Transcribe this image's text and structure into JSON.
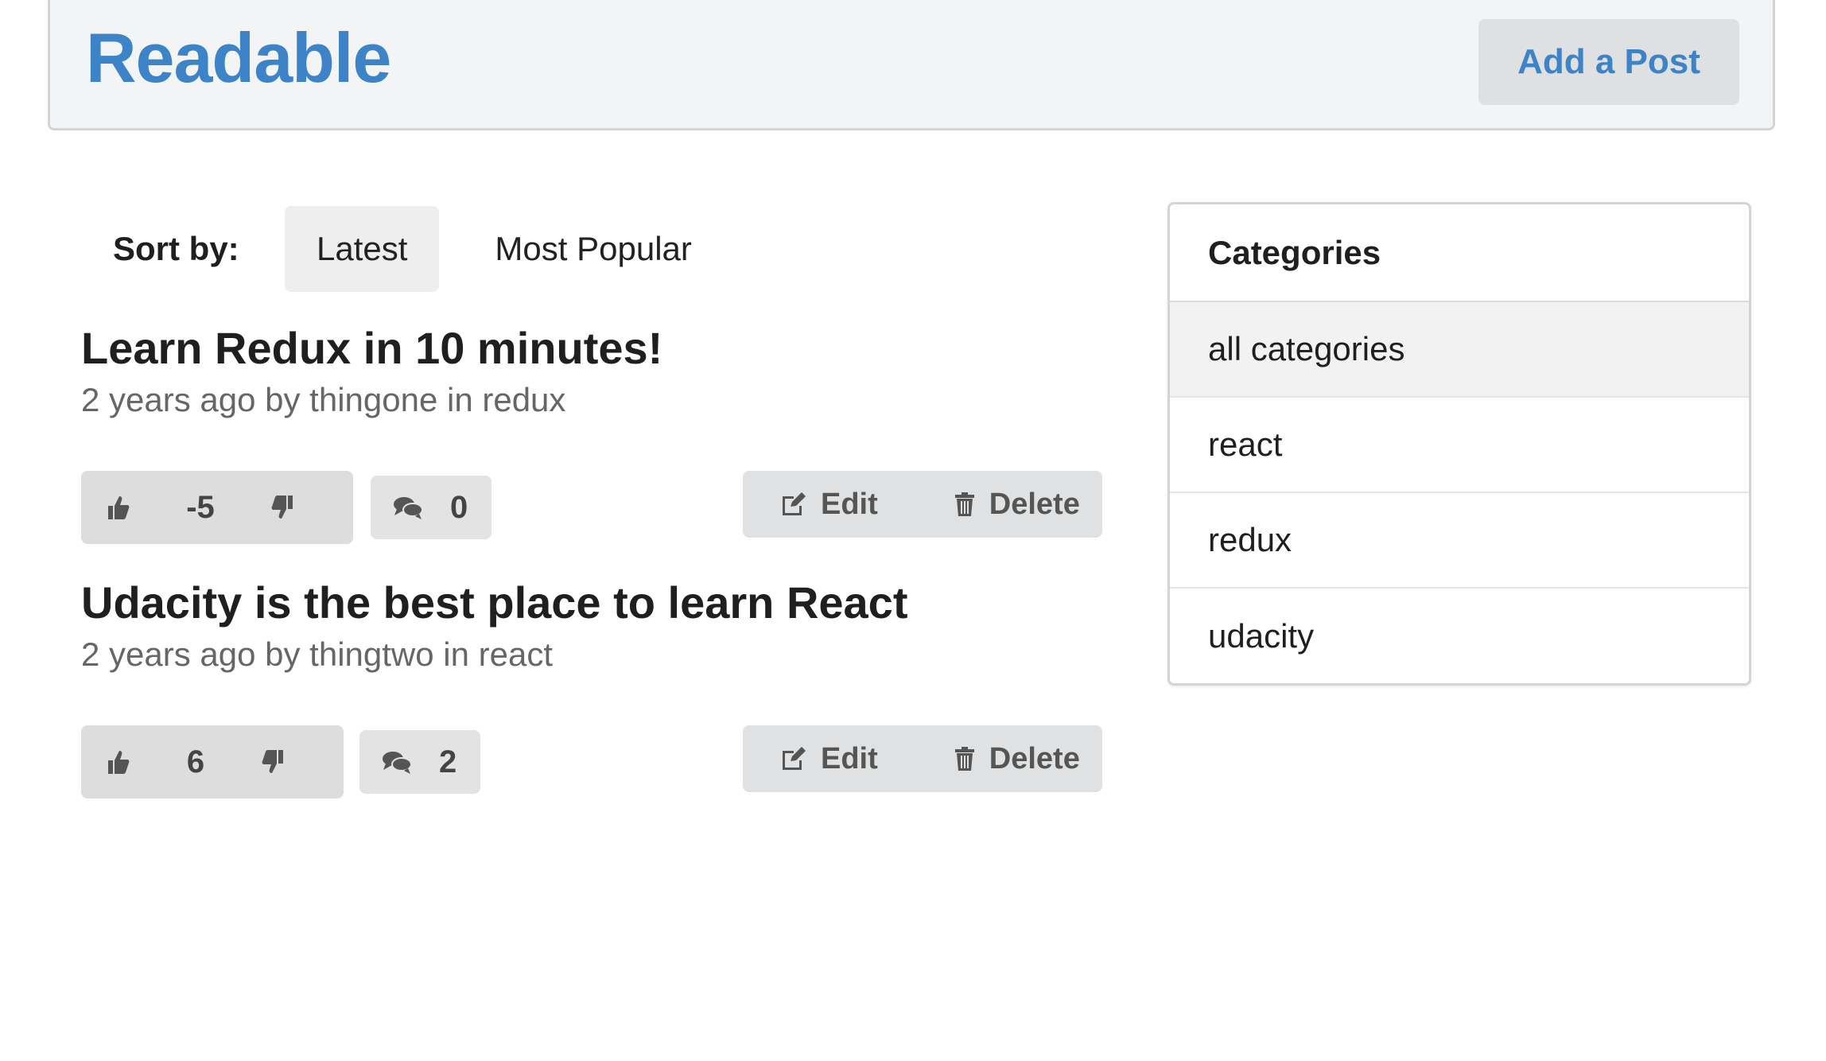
{
  "header": {
    "brand": "Readable",
    "add_post_label": "Add a Post"
  },
  "sort": {
    "label": "Sort by:",
    "options": [
      "Latest",
      "Most Popular"
    ],
    "active": "Latest"
  },
  "posts": [
    {
      "title": "Learn Redux in 10 minutes!",
      "meta": "2 years ago by thingone in redux",
      "score": "-5",
      "comments": "0",
      "edit_label": "Edit",
      "delete_label": "Delete"
    },
    {
      "title": "Udacity is the best place to learn React",
      "meta": "2 years ago by thingtwo in react",
      "score": "6",
      "comments": "2",
      "edit_label": "Edit",
      "delete_label": "Delete"
    }
  ],
  "categories": {
    "title": "Categories",
    "items": [
      "all categories",
      "react",
      "redux",
      "udacity"
    ],
    "active": "all categories"
  },
  "colors": {
    "brand": "#3d83c8",
    "button_bg": "#e0e1e2",
    "header_bg": "#f3f4f5"
  },
  "icons": {
    "upvote": "thumbs-up-icon",
    "downvote": "thumbs-down-icon",
    "comments": "comments-icon",
    "edit": "edit-icon",
    "delete": "trash-icon"
  }
}
